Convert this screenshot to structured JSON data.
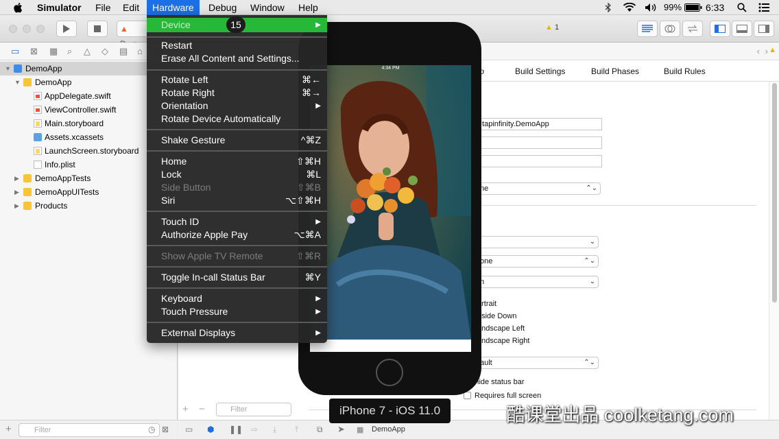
{
  "menubar": {
    "apple": "",
    "items": [
      "Simulator",
      "File",
      "Edit",
      "Hardware",
      "Debug",
      "Window",
      "Help"
    ],
    "battery": "99%",
    "time": "6:33"
  },
  "toolbar": {
    "scheme_label": "D...p",
    "warning_count": "1"
  },
  "navigator": {
    "files": [
      {
        "label": "DemoApp",
        "kind": "proj"
      },
      {
        "label": "DemoApp",
        "kind": "folder"
      },
      {
        "label": "AppDelegate.swift",
        "kind": "swift"
      },
      {
        "label": "ViewController.swift",
        "kind": "swift"
      },
      {
        "label": "Main.storyboard",
        "kind": "sb"
      },
      {
        "label": "Assets.xcassets",
        "kind": "assets"
      },
      {
        "label": "LaunchScreen.storyboard",
        "kind": "sb"
      },
      {
        "label": "Info.plist",
        "kind": "plist"
      },
      {
        "label": "DemoAppTests",
        "kind": "folder"
      },
      {
        "label": "DemoAppUITests",
        "kind": "folder"
      },
      {
        "label": "Products",
        "kind": "folder"
      }
    ],
    "filter_placeholder": "Filter"
  },
  "editor": {
    "tabs": [
      "fo",
      "Build Settings",
      "Build Phases",
      "Build Rules"
    ],
    "bundle_id": ".tapinfinity.DemoApp",
    "popup1": "ne",
    "popup2": "",
    "popup3": "one",
    "popup4": "n",
    "orientations": [
      "ortrait",
      "pside Down",
      "andscape Left",
      "andscape Right"
    ],
    "popup5": "ault",
    "hide_status_bar": "lide status bar",
    "requires_full_screen": "Requires full screen",
    "filter_placeholder": "Filter",
    "bottom_target": "DemoApp"
  },
  "simulator": {
    "status_time": "4:34 PM",
    "device_label": "iPhone 7 - iOS 11.0"
  },
  "hardware_menu": {
    "step_counter": "15",
    "groups": [
      [
        {
          "label": "Device",
          "key": "▶",
          "highlighted": true
        }
      ],
      [
        {
          "label": "Restart",
          "key": ""
        },
        {
          "label": "Erase All Content and Settings...",
          "key": ""
        }
      ],
      [
        {
          "label": "Rotate Left",
          "key": "⌘←"
        },
        {
          "label": "Rotate Right",
          "key": "⌘→"
        },
        {
          "label": "Orientation",
          "key": "▶"
        },
        {
          "label": "Rotate Device Automatically",
          "key": ""
        }
      ],
      [
        {
          "label": "Shake Gesture",
          "key": "^⌘Z"
        }
      ],
      [
        {
          "label": "Home",
          "key": "⇧⌘H"
        },
        {
          "label": "Lock",
          "key": "⌘L"
        },
        {
          "label": "Side Button",
          "key": "⇧⌘B",
          "disabled": true
        },
        {
          "label": "Siri",
          "key": "⌥⇧⌘H"
        }
      ],
      [
        {
          "label": "Touch ID",
          "key": "▶"
        },
        {
          "label": "Authorize Apple Pay",
          "key": "⌥⌘A"
        }
      ],
      [
        {
          "label": "Show Apple TV Remote",
          "key": "⇧⌘R",
          "disabled": true
        }
      ],
      [
        {
          "label": "Toggle In-call Status Bar",
          "key": "⌘Y"
        }
      ],
      [
        {
          "label": "Keyboard",
          "key": "▶"
        },
        {
          "label": "Touch Pressure",
          "key": "▶"
        }
      ],
      [
        {
          "label": "External Displays",
          "key": "▶"
        }
      ]
    ]
  },
  "watermark": "酷课堂出品 coolketang.com",
  "colors": {
    "menu_highlight": "#27b83a",
    "menubar_active": "#1d6fe5"
  }
}
